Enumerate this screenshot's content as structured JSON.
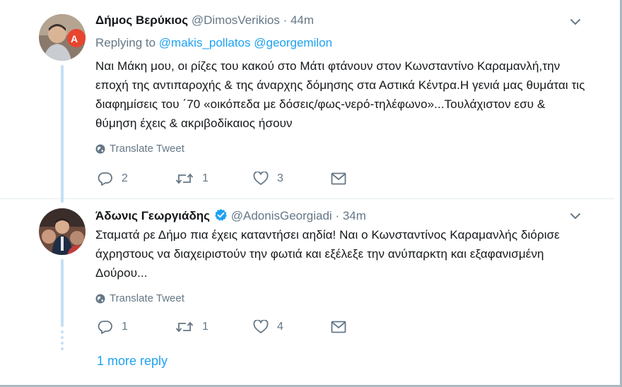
{
  "tweets": [
    {
      "name": "Δήμος Βερύκιος",
      "handle": "@DimosVerikios",
      "separator": "·",
      "time": "44m",
      "replying_prefix": "Replying to",
      "replying_mentions": [
        "@makis_pollatos",
        "@georgemilon"
      ],
      "text": "Ναι Μάκη μου, οι ρίζες του κακού στο Μάτι φτάνουν στον Κωνσταντίνο Καραμανλή,την εποχή της αντιπαροχής & της άναρχης δόμησης στα Αστικά Κέντρα.Η γενιά μας θυμάται τις διαφημίσεις του ΄70 «οικόπεδα με δόσεις/φως-νερό-τηλέφωνο»...Τουλάχιστον εσυ & θύμηση έχεις & ακριβοδίκαιος ήσουν",
      "translate": "Translate Tweet",
      "replies": "2",
      "retweets": "1",
      "likes": "3"
    },
    {
      "name": "Άδωνις Γεωργιάδης",
      "handle": "@AdonisGeorgiadi",
      "separator": "·",
      "time": "34m",
      "text": "Σταματά ρε Δήμο πια έχεις καταντήσει αηδία! Ναι ο Κωνσταντίνος Καραμανλής διόρισε άχρηστους να διαχειριστούν την φωτιά και εξέλεξε την ανύπαρκτη και εξαφανισμένη Δούρου...",
      "translate": "Translate Tweet",
      "replies": "1",
      "retweets": "1",
      "likes": "4"
    }
  ],
  "more_reply": "1 more reply",
  "icons": {
    "reply": "reply-icon",
    "retweet": "retweet-icon",
    "like": "heart-icon",
    "dm": "envelope-icon",
    "globe": "globe-icon",
    "caret": "chevron-down-icon",
    "verified": "verified-badge-icon"
  },
  "colors": {
    "link": "#1da1f2",
    "muted": "#657786",
    "thread": "#c4dff5"
  }
}
